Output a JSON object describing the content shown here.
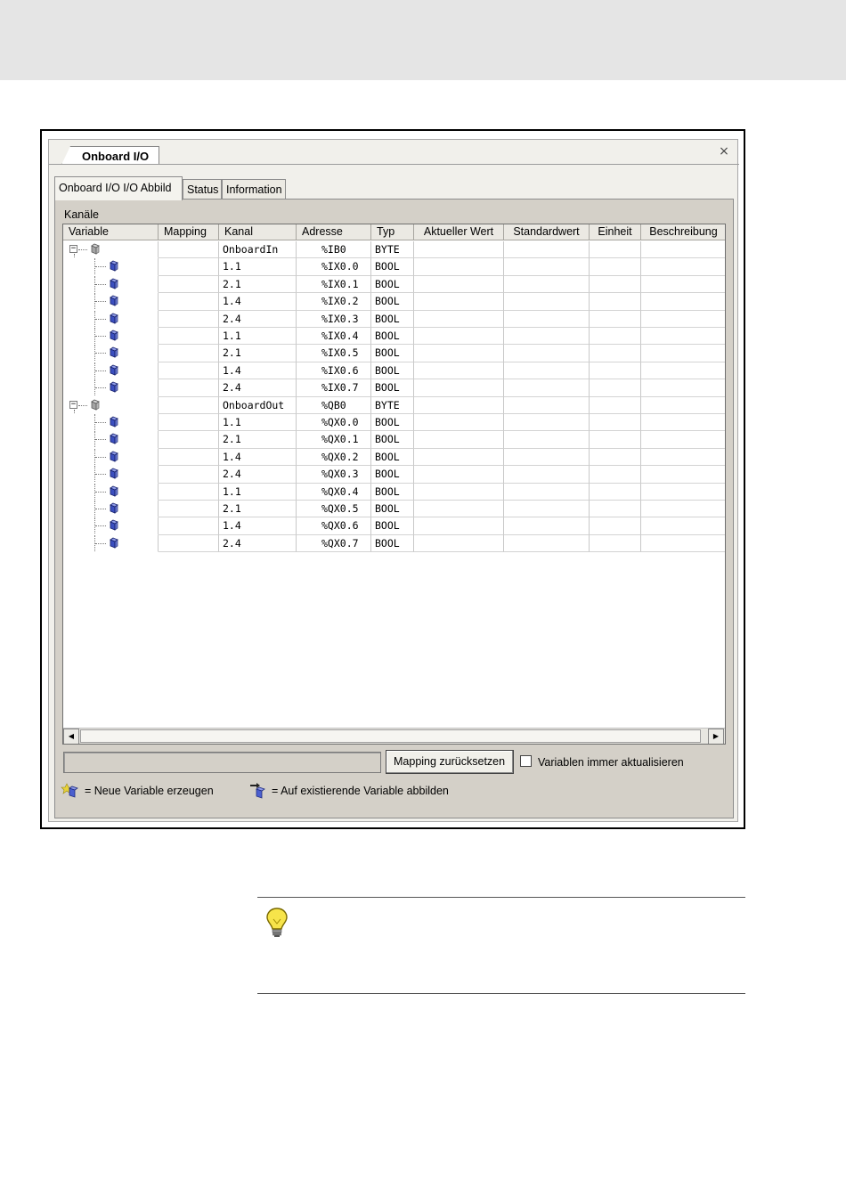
{
  "window": {
    "doc_tab": "Onboard I/O",
    "close_symbol": "×",
    "tabs": [
      {
        "label": "Onboard I/O I/O Abbild",
        "active": true
      },
      {
        "label": "Status",
        "active": false
      },
      {
        "label": "Information",
        "active": false
      }
    ],
    "group_label": "Kanäle"
  },
  "grid": {
    "columns": [
      "Variable",
      "Mapping",
      "Kanal",
      "Adresse",
      "Typ",
      "Aktueller Wert",
      "Standardwert",
      "Einheit",
      "Beschreibung"
    ],
    "rows": [
      {
        "level": 0,
        "kanal": "OnboardIn",
        "adresse": "%IB0",
        "typ": "BYTE"
      },
      {
        "level": 1,
        "kanal": "1.1",
        "adresse": "%IX0.0",
        "typ": "BOOL"
      },
      {
        "level": 1,
        "kanal": "2.1",
        "adresse": "%IX0.1",
        "typ": "BOOL"
      },
      {
        "level": 1,
        "kanal": "1.4",
        "adresse": "%IX0.2",
        "typ": "BOOL"
      },
      {
        "level": 1,
        "kanal": "2.4",
        "adresse": "%IX0.3",
        "typ": "BOOL"
      },
      {
        "level": 1,
        "kanal": "1.1",
        "adresse": "%IX0.4",
        "typ": "BOOL"
      },
      {
        "level": 1,
        "kanal": "2.1",
        "adresse": "%IX0.5",
        "typ": "BOOL"
      },
      {
        "level": 1,
        "kanal": "1.4",
        "adresse": "%IX0.6",
        "typ": "BOOL"
      },
      {
        "level": 1,
        "kanal": "2.4",
        "adresse": "%IX0.7",
        "typ": "BOOL"
      },
      {
        "level": 0,
        "kanal": "OnboardOut",
        "adresse": "%QB0",
        "typ": "BYTE"
      },
      {
        "level": 1,
        "kanal": "1.1",
        "adresse": "%QX0.0",
        "typ": "BOOL"
      },
      {
        "level": 1,
        "kanal": "2.1",
        "adresse": "%QX0.1",
        "typ": "BOOL"
      },
      {
        "level": 1,
        "kanal": "1.4",
        "adresse": "%QX0.2",
        "typ": "BOOL"
      },
      {
        "level": 1,
        "kanal": "2.4",
        "adresse": "%QX0.3",
        "typ": "BOOL"
      },
      {
        "level": 1,
        "kanal": "1.1",
        "adresse": "%QX0.4",
        "typ": "BOOL"
      },
      {
        "level": 1,
        "kanal": "2.1",
        "adresse": "%QX0.5",
        "typ": "BOOL"
      },
      {
        "level": 1,
        "kanal": "1.4",
        "adresse": "%QX0.6",
        "typ": "BOOL"
      },
      {
        "level": 1,
        "kanal": "2.4",
        "adresse": "%QX0.7",
        "typ": "BOOL"
      }
    ],
    "expander_symbol": "−"
  },
  "footer": {
    "reset_button": "Mapping zurücksetzen",
    "checkbox_label": "Variablen immer aktualisieren",
    "checkbox_checked": false,
    "legend_new": "= Neue Variable erzeugen",
    "legend_map": "= Auf existierende Variable abbilden"
  },
  "icons": {
    "node": "variable-node-icon",
    "new_variable": "new-variable-icon",
    "map_variable": "map-variable-icon",
    "tip": "lightbulb-icon"
  },
  "colors": {
    "panel": "#d4d0c8",
    "channel_icon": "#3b4fbf",
    "group_icon": "#a0a0a0",
    "bulb": "#f7e44a"
  }
}
